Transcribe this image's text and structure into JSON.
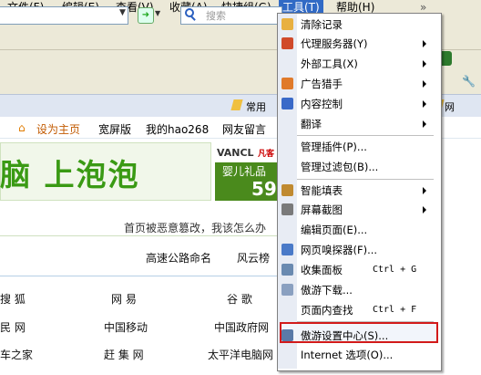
{
  "menubar": {
    "items": [
      "文件(F)",
      "编辑(E)",
      "查看(V)",
      "收藏(A)",
      "快捷组(G)",
      "工具(T)",
      "帮助(H)"
    ],
    "overflow": "»"
  },
  "toolbar": {
    "search_placeholder": "搜索"
  },
  "favorites_bar": {
    "common": "常用",
    "right_item": "网"
  },
  "page": {
    "nav_links": [
      "设为主页",
      "宽屏版",
      "我的hao268",
      "网友留言"
    ],
    "banner_text": "脑 上泡泡",
    "ad": {
      "brand": "VANCL",
      "brand_suffix": "凡客",
      "line1": "婴儿礼品",
      "line2": "59"
    },
    "notice": "首页被恶意篡改，我该怎么办",
    "row1": [
      "高速公路命名",
      "风云榜"
    ],
    "row2": [
      "搜  狐",
      "网  易",
      "谷  歌"
    ],
    "row3": [
      "民 网",
      "中国移动",
      "中国政府网"
    ],
    "row4": [
      "车之家",
      "赶 集 网",
      "太平洋电脑网"
    ]
  },
  "tools_menu": {
    "items": [
      {
        "label": "清除记录",
        "shortcut": "",
        "submenu": false,
        "icon": "broom-icon",
        "color": "#e8b040"
      },
      {
        "label": "代理服务器(Y)",
        "shortcut": "",
        "submenu": true,
        "icon": "proxy-icon",
        "color": "#d04a2a"
      },
      {
        "label": "外部工具(X)",
        "shortcut": "",
        "submenu": true,
        "icon": "",
        "color": ""
      },
      {
        "label": "广告猎手",
        "shortcut": "",
        "submenu": true,
        "icon": "ad-hunter-icon",
        "color": "#e07a2a"
      },
      {
        "label": "内容控制",
        "shortcut": "",
        "submenu": true,
        "icon": "content-control-icon",
        "color": "#3a6ac8"
      },
      {
        "label": "翻译",
        "shortcut": "",
        "submenu": true,
        "icon": "",
        "color": ""
      },
      {
        "label": "管理插件(P)...",
        "shortcut": "",
        "submenu": false,
        "icon": "",
        "color": ""
      },
      {
        "label": "管理过滤包(B)...",
        "shortcut": "",
        "submenu": false,
        "icon": "",
        "color": ""
      },
      {
        "label": "智能填表",
        "shortcut": "",
        "submenu": true,
        "icon": "form-fill-icon",
        "color": "#c08a30"
      },
      {
        "label": "屏幕截图",
        "shortcut": "",
        "submenu": true,
        "icon": "screenshot-icon",
        "color": "#7a7a7a"
      },
      {
        "label": "编辑页面(E)...",
        "shortcut": "",
        "submenu": false,
        "icon": "",
        "color": ""
      },
      {
        "label": "网页嗅探器(F)...",
        "shortcut": "",
        "submenu": false,
        "icon": "sniffer-icon",
        "color": "#4a7ac8"
      },
      {
        "label": "收集面板",
        "shortcut": "Ctrl + G",
        "submenu": false,
        "icon": "collect-panel-icon",
        "color": "#6a8ab0"
      },
      {
        "label": "傲游下载...",
        "shortcut": "",
        "submenu": false,
        "icon": "download-icon",
        "color": "#8aa0c0"
      },
      {
        "label": "页面内查找",
        "shortcut": "Ctrl + F",
        "submenu": false,
        "icon": "",
        "color": ""
      },
      {
        "label": "傲游设置中心(S)...",
        "shortcut": "",
        "submenu": false,
        "icon": "settings-center-icon",
        "color": "#5a7aa8"
      },
      {
        "label": "Internet 选项(O)...",
        "shortcut": "",
        "submenu": false,
        "icon": "",
        "color": ""
      }
    ],
    "highlight_color": "#d21a1a"
  }
}
